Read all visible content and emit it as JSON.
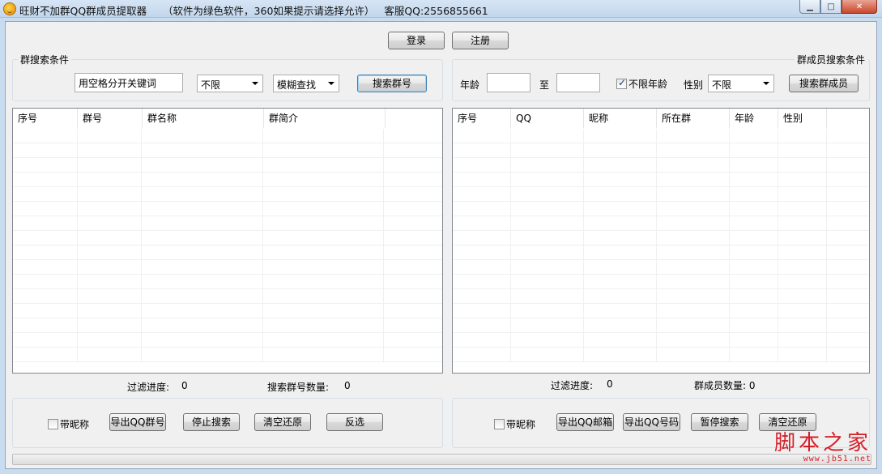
{
  "window": {
    "title": "旺财不加群QQ群成员提取器     （软件为绿色软件，360如果提示请选择允许）   客服QQ:2556855661",
    "minimize_glyph": "▁",
    "maximize_glyph": "□",
    "close_glyph": "✕"
  },
  "account": {
    "login_label": "登录",
    "register_label": "注册"
  },
  "group_search": {
    "legend": "群搜索条件",
    "keyword_value": "用空格分开关键词",
    "filter_value": "不限",
    "match_value": "模糊查找",
    "search_button": "搜索群号"
  },
  "member_search": {
    "legend": "群成员搜索条件",
    "age_label": "年龄",
    "age_from": "",
    "to_label": "至",
    "age_to": "",
    "unlimited_age_label": "不限年龄",
    "unlimited_age_checked": true,
    "gender_label": "性别",
    "gender_value": "不限",
    "search_button": "搜索群成员"
  },
  "group_list": {
    "columns": [
      "序号",
      "群号",
      "群名称",
      "群简介",
      ""
    ],
    "rows": []
  },
  "member_list": {
    "columns": [
      "序号",
      "QQ",
      "昵称",
      "所在群",
      "年龄",
      "性别",
      ""
    ],
    "rows": []
  },
  "group_status": {
    "progress_label": "过滤进度:",
    "progress_value": "0",
    "count_label": "搜索群号数量:",
    "count_value": "0"
  },
  "member_status": {
    "progress_label": "过滤进度:",
    "progress_value": "0",
    "count_label": "群成员数量: 0"
  },
  "group_actions": {
    "with_nickname_label": "带昵称",
    "with_nickname_checked": false,
    "export_button": "导出QQ群号",
    "stop_button": "停止搜索",
    "clear_button": "清空还原",
    "invert_button": "反选"
  },
  "member_actions": {
    "with_nickname_label": "带昵称",
    "with_nickname_checked": false,
    "export_email_button": "导出QQ邮箱",
    "export_qq_button": "导出QQ号码",
    "pause_button": "暂停搜索",
    "clear_button": "清空还原"
  },
  "progress": {
    "value": 0
  },
  "watermark": {
    "main": "脚本之家",
    "sub": "www.jb51.net"
  },
  "colors": {
    "watermark": "#d4202a",
    "progress_fill": "#37d32b",
    "window_frame": "#c9dbee"
  }
}
